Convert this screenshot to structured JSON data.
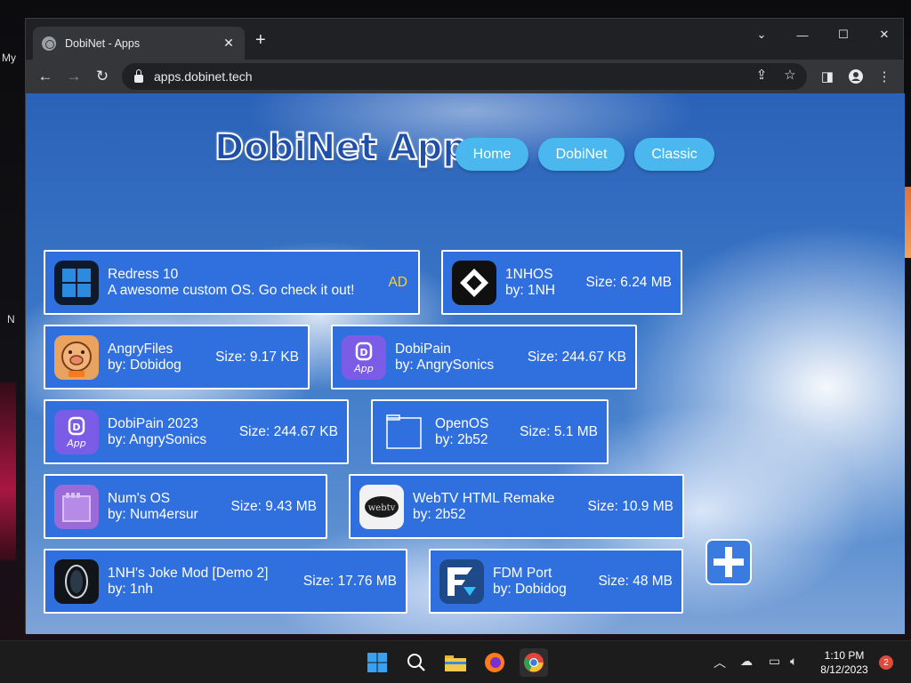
{
  "browser": {
    "tab_title": "DobiNet - Apps",
    "url": "apps.dobinet.tech"
  },
  "desktop": {
    "label_my": "My",
    "label_n": "N"
  },
  "site": {
    "logo_text": "DobiNet Apps",
    "nav": [
      {
        "label": "Home"
      },
      {
        "label": "DobiNet"
      },
      {
        "label": "Classic"
      }
    ]
  },
  "apps": [
    {
      "name": "Redress 10",
      "desc": "A awesome custom OS. Go check it out!",
      "badge": "AD",
      "icon": "windows-logo-icon"
    },
    {
      "name": "1NHOS",
      "author": "by: 1NH",
      "size": "Size: 6.24 MB",
      "icon": "1nhos-icon"
    },
    {
      "name": "AngryFiles",
      "author": "by: Dobidog",
      "size": "Size: 9.17 KB",
      "icon": "angry-pig-icon"
    },
    {
      "name": "DobiPain",
      "author": "by: AngrySonics",
      "size": "Size: 244.67 KB",
      "icon": "dobi-app-icon"
    },
    {
      "name": "DobiPain 2023",
      "author": "by: AngrySonics",
      "size": "Size: 244.67 KB",
      "icon": "dobi-app-icon"
    },
    {
      "name": "OpenOS",
      "author": "by: 2b52",
      "size": "Size: 5.1 MB",
      "icon": "window-outline-icon"
    },
    {
      "name": "Num's OS",
      "author": "by: Num4ersur",
      "size": "Size: 9.43 MB",
      "icon": "purple-window-icon"
    },
    {
      "name": "WebTV HTML Remake",
      "author": "by: 2b52",
      "size": "Size: 10.9 MB",
      "icon": "webtv-icon"
    },
    {
      "name": "1NH's Joke Mod [Demo 2]",
      "author": "by: 1nh",
      "size": "Size: 17.76 MB",
      "icon": "portal-icon"
    },
    {
      "name": "FDM Port",
      "author": "by: Dobidog",
      "size": "Size: 48 MB",
      "icon": "fdm-icon"
    }
  ],
  "taskbar": {
    "time": "1:10 PM",
    "date": "8/12/2023",
    "notification_count": "2"
  }
}
